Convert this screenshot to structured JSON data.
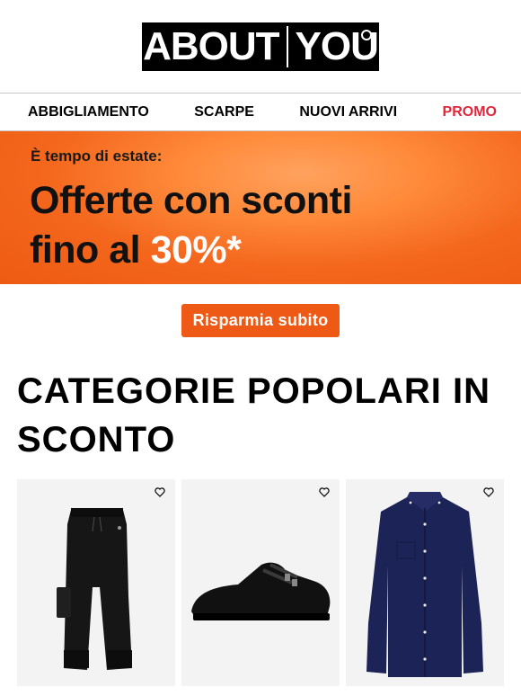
{
  "brand": {
    "logo_text_left": "ABOUT",
    "logo_text_right": "YOU"
  },
  "nav": {
    "items": [
      {
        "label": "ABBIGLIAMENTO"
      },
      {
        "label": "SCARPE"
      },
      {
        "label": "NUOVI ARRIVI"
      },
      {
        "label": "PROMO"
      }
    ]
  },
  "banner": {
    "kicker": "È tempo di estate:",
    "headline_line1": "Offerte con sconti",
    "headline_line2_prefix": "fino al ",
    "headline_highlight": "30%*"
  },
  "cta": {
    "label": "Risparmia subito"
  },
  "section": {
    "title": "CATEGORIE POPOLARI IN SCONTO"
  },
  "products": [
    {
      "icon": "jogger-pants-image"
    },
    {
      "icon": "dress-shoe-image"
    },
    {
      "icon": "shirt-image"
    }
  ],
  "colors": {
    "accent": "#ee5a16",
    "promo": "#e0263a",
    "banner": "#f4671d"
  }
}
